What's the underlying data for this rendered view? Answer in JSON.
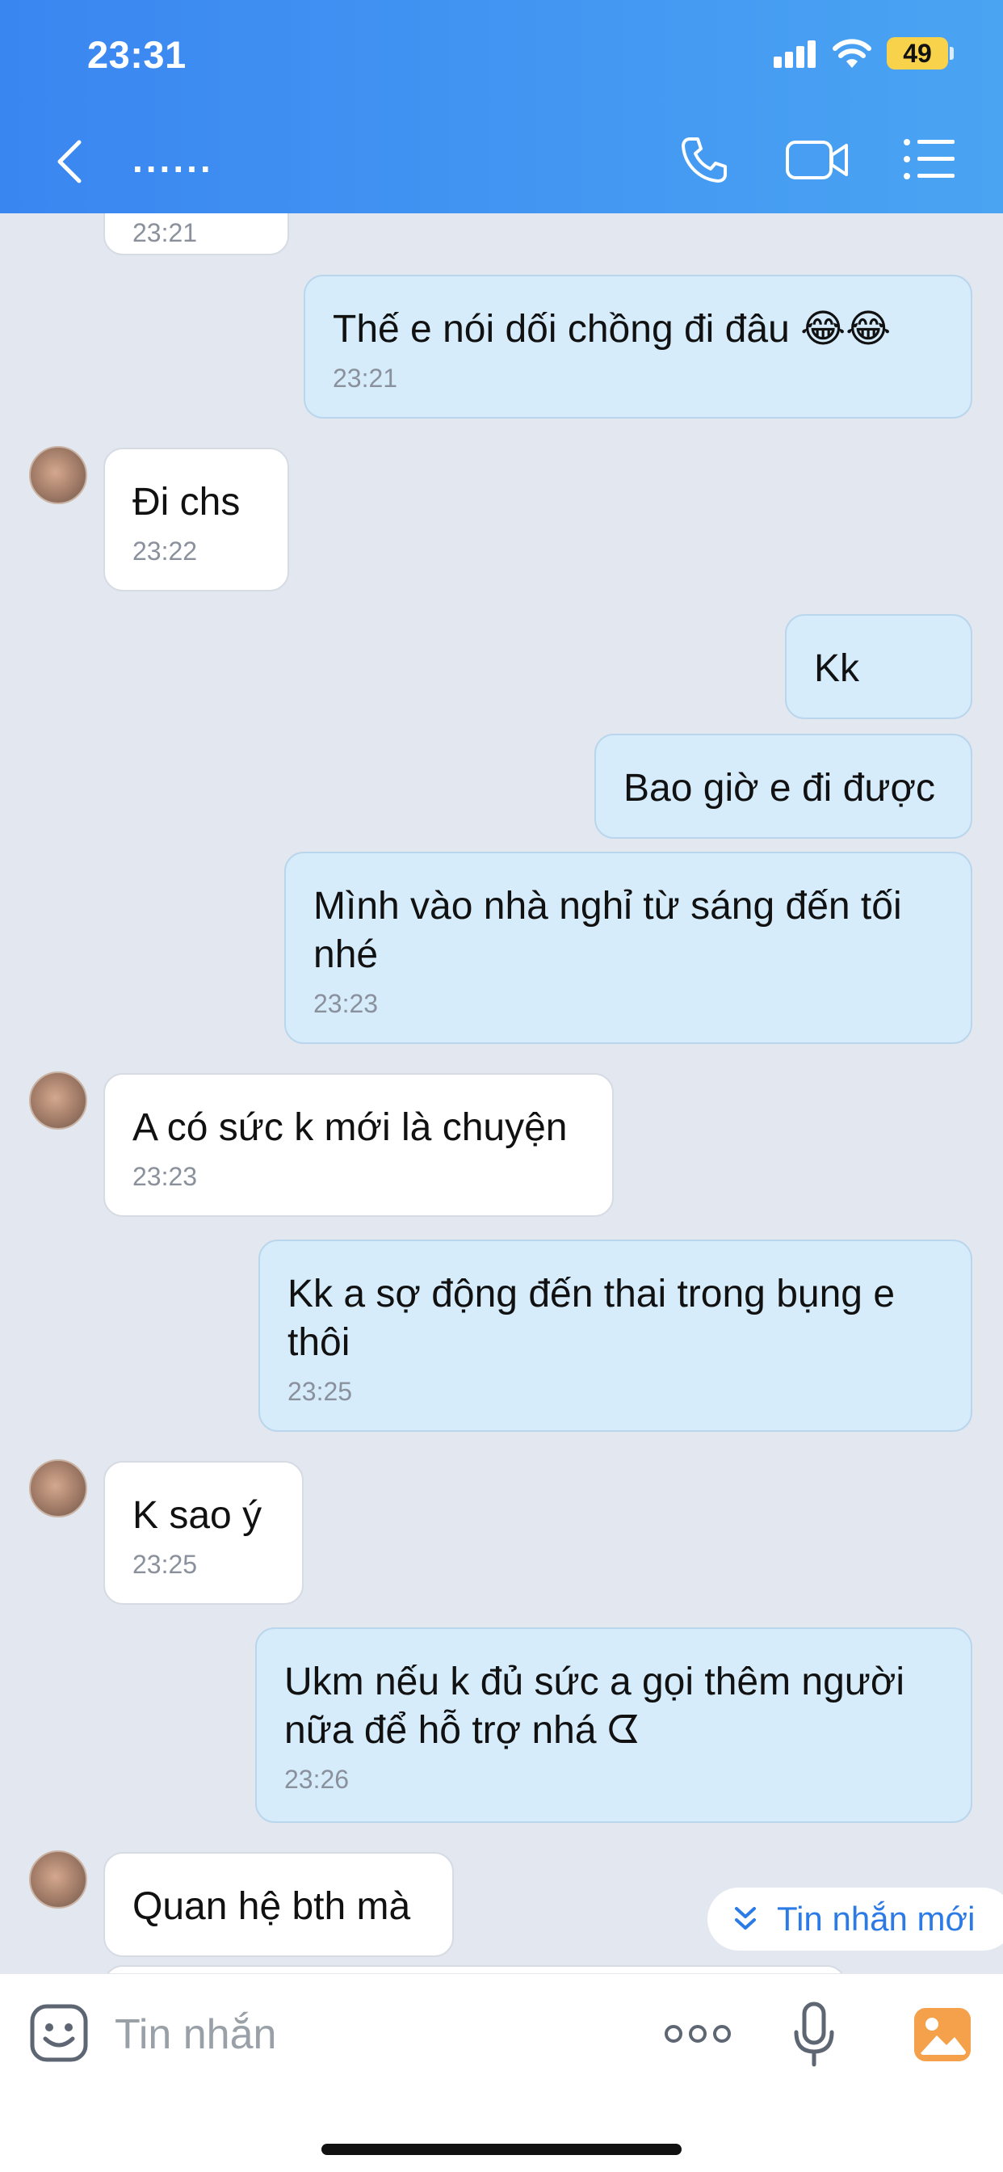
{
  "status_bar": {
    "time": "23:31",
    "battery": "49"
  },
  "header": {
    "title": "......"
  },
  "messages": [
    {
      "time": "23:21"
    },
    {
      "text": "Thế e nói dối chồng đi đâu 😂😂",
      "time": "23:21"
    },
    {
      "text": "Đi chs",
      "time": "23:22"
    },
    {
      "text": "Kk"
    },
    {
      "text": "Bao giờ e đi được"
    },
    {
      "text": "Mình vào nhà nghỉ từ sáng đến tối nhé",
      "time": "23:23"
    },
    {
      "text": "A có sức k mới là chuyện",
      "time": "23:23"
    },
    {
      "text": "Kk a sợ động đến thai trong bụng e thôi",
      "time": "23:25"
    },
    {
      "text": "K sao  ý",
      "time": "23:25"
    },
    {
      "text": "Ukm nếu k đủ sức a gọi thêm người nữa để hỗ trợ nhá ᗧ",
      "time": "23:26"
    },
    {
      "text": "Quan hệ bth mà"
    }
  ],
  "new_messages_label": "Tin nhắn mới",
  "input": {
    "placeholder": "Tin nhắn"
  },
  "colors": {
    "header_start": "#3a86f1",
    "header_end": "#4aa4f2",
    "outgoing_bubble": "#d6ecfb",
    "incoming_bubble": "#ffffff",
    "accent": "#2b7ae6"
  }
}
